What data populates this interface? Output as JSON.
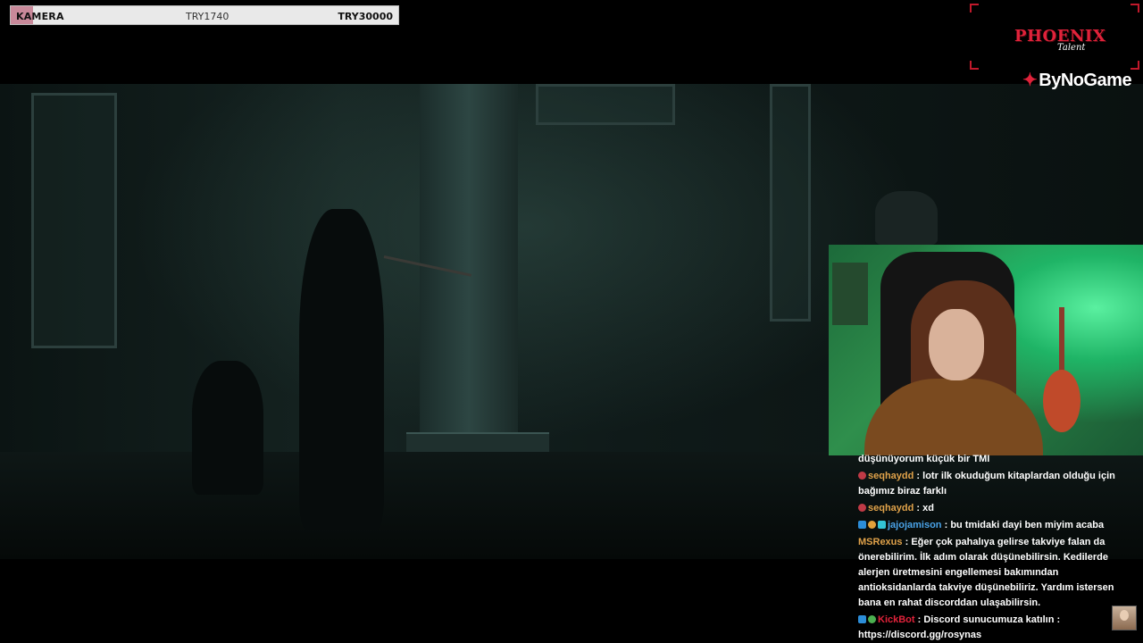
{
  "goal": {
    "label": "KAMERA",
    "current": "TRY1740",
    "target": "TRY30000",
    "progress": 0.058,
    "fill_color": "#c9899a"
  },
  "branding": {
    "phoenix_text": "PHOENIX",
    "phoenix_sub": "Talent",
    "bynogame_text": "ByNoGame",
    "accent_color": "#e0223a"
  },
  "chat": {
    "partial_line": "düşünüyorum küçük bir TMI",
    "messages": [
      {
        "user": "seqhaydd",
        "user_color": "#e0a24a",
        "badges": [
          "red"
        ],
        "text": "lotr ilk okuduğum kitaplardan olduğu için bağımız biraz farklı"
      },
      {
        "user": "seqhaydd",
        "user_color": "#e0a24a",
        "badges": [
          "red"
        ],
        "text": "xd"
      },
      {
        "user": "jajojamison",
        "user_color": "#4aa3e8",
        "badges": [
          "blue",
          "yellow",
          "cyan"
        ],
        "text": "bu tmidaki dayi ben miyim acaba"
      },
      {
        "user": "MSRexus",
        "user_color": "#e0a24a",
        "badges": [],
        "text": "Eğer çok pahalıya gelirse takviye falan da önerebilirim. İlk adım olarak düşünebilirsin. Kedilerde alerjen üretmesini engellemesi bakımından antioksidanlarda takviye düşünebiliriz. Yardım istersen bana en rahat discorddan ulaşabilirsin."
      },
      {
        "user": "KickBot",
        "user_color": "#e0223a",
        "badges": [
          "blue",
          "green"
        ],
        "text": "Discord sunucumuza katılın : https://discord.gg/rosynas"
      }
    ]
  }
}
